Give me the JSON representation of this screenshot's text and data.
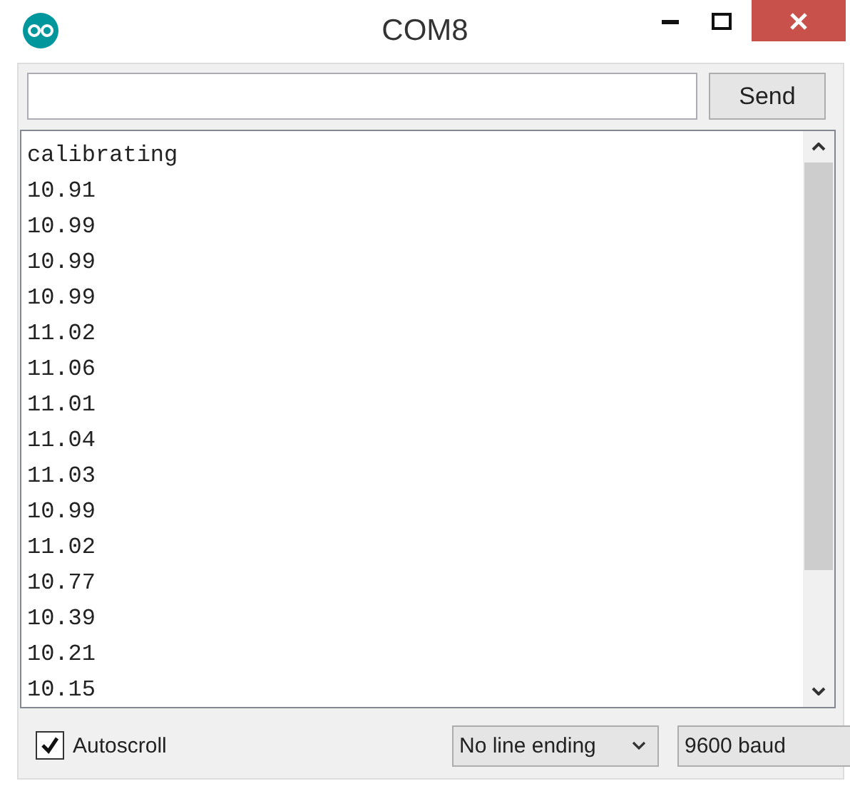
{
  "window": {
    "title": "COM8"
  },
  "send_button": "Send",
  "output_lines": [
    "calibrating",
    "10.91",
    "10.99",
    "10.99",
    "10.99",
    "11.02",
    "11.06",
    "11.01",
    "11.04",
    "11.03",
    "10.99",
    "11.02",
    "10.77",
    "10.39",
    "10.21",
    "10.15"
  ],
  "autoscroll": {
    "label": "Autoscroll",
    "checked": true
  },
  "line_ending": "No line ending",
  "baud": "9600 baud"
}
